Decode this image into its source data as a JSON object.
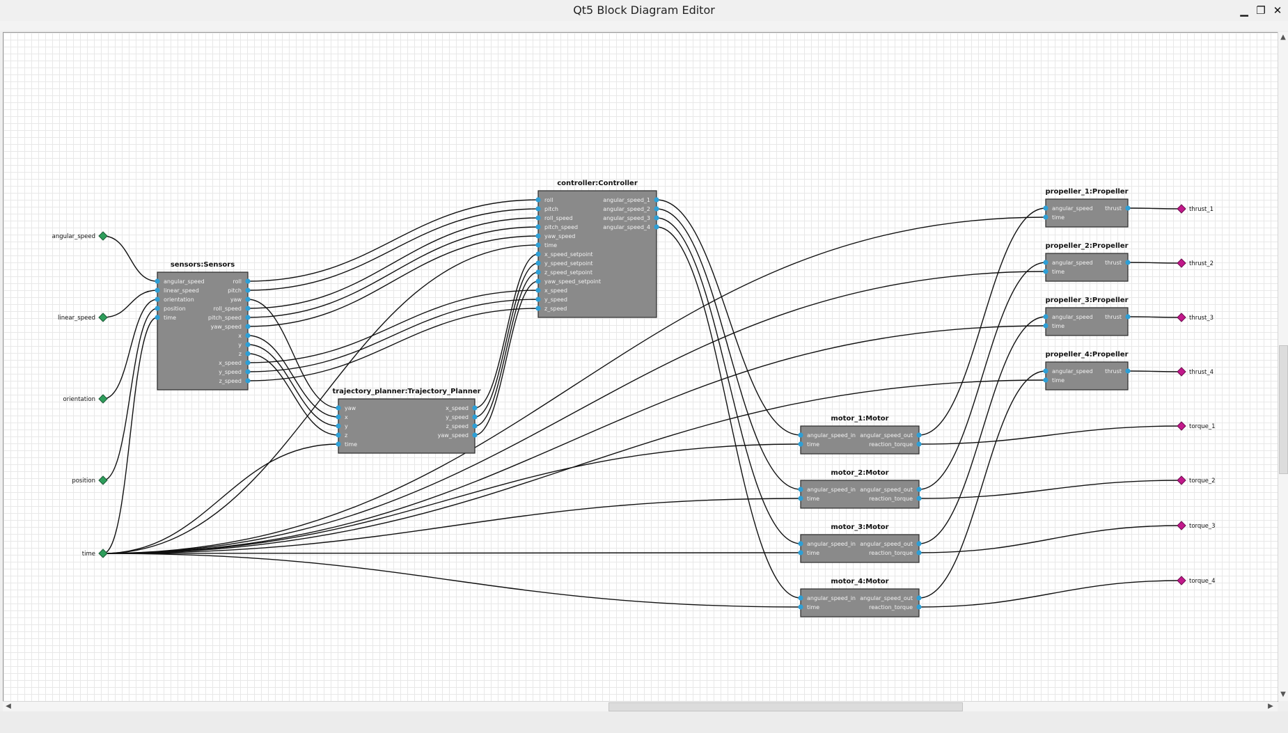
{
  "window": {
    "title": "Qt5 Block Diagram Editor",
    "min_glyph": "▁",
    "max_glyph": "❐",
    "close_glyph": "✕"
  },
  "scroll": {
    "up": "▲",
    "down": "▼",
    "left": "◀",
    "right": "▶"
  },
  "colors": {
    "block_fill": "#8a8a8a",
    "block_border": "#2a2a2a",
    "port": "#2d9fd6",
    "input_terminal": "#2e9e5b",
    "output_terminal": "#c2188b",
    "wire": "#111111",
    "grid": "#e8e8e8"
  },
  "inputs": [
    {
      "id": "angular_speed",
      "label": "angular_speed"
    },
    {
      "id": "linear_speed",
      "label": "linear_speed"
    },
    {
      "id": "orientation",
      "label": "orientation"
    },
    {
      "id": "position",
      "label": "position"
    },
    {
      "id": "time",
      "label": "time"
    }
  ],
  "outputs": [
    {
      "id": "thrust_1",
      "label": "thrust_1"
    },
    {
      "id": "thrust_2",
      "label": "thrust_2"
    },
    {
      "id": "thrust_3",
      "label": "thrust_3"
    },
    {
      "id": "thrust_4",
      "label": "thrust_4"
    },
    {
      "id": "torque_1",
      "label": "torque_1"
    },
    {
      "id": "torque_2",
      "label": "torque_2"
    },
    {
      "id": "torque_3",
      "label": "torque_3"
    },
    {
      "id": "torque_4",
      "label": "torque_4"
    }
  ],
  "blocks": [
    {
      "id": "sensors",
      "title": "sensors:Sensors",
      "inputs": [
        "angular_speed",
        "linear_speed",
        "orientation",
        "position",
        "time"
      ],
      "outputs": [
        "roll",
        "pitch",
        "yaw",
        "roll_speed",
        "pitch_speed",
        "yaw_speed",
        "x",
        "y",
        "z",
        "x_speed",
        "y_speed",
        "z_speed"
      ]
    },
    {
      "id": "controller",
      "title": "controller:Controller",
      "inputs": [
        "roll",
        "pitch",
        "roll_speed",
        "pitch_speed",
        "yaw_speed",
        "time",
        "x_speed_setpoint",
        "y_speed_setpoint",
        "z_speed_setpoint",
        "yaw_speed_setpoint",
        "x_speed",
        "y_speed",
        "z_speed"
      ],
      "outputs": [
        "angular_speed_1",
        "angular_speed_2",
        "angular_speed_3",
        "angular_speed_4"
      ]
    },
    {
      "id": "trajectory_planner",
      "title": "trajectory_planner:Trajectory_Planner",
      "inputs": [
        "yaw",
        "x",
        "y",
        "z",
        "time"
      ],
      "outputs": [
        "x_speed",
        "y_speed",
        "z_speed",
        "yaw_speed"
      ]
    },
    {
      "id": "propeller_1",
      "title": "propeller_1:Propeller",
      "inputs": [
        "angular_speed",
        "time"
      ],
      "outputs": [
        "thrust"
      ]
    },
    {
      "id": "propeller_2",
      "title": "propeller_2:Propeller",
      "inputs": [
        "angular_speed",
        "time"
      ],
      "outputs": [
        "thrust"
      ]
    },
    {
      "id": "propeller_3",
      "title": "propeller_3:Propeller",
      "inputs": [
        "angular_speed",
        "time"
      ],
      "outputs": [
        "thrust"
      ]
    },
    {
      "id": "propeller_4",
      "title": "propeller_4:Propeller",
      "inputs": [
        "angular_speed",
        "time"
      ],
      "outputs": [
        "thrust"
      ]
    },
    {
      "id": "motor_1",
      "title": "motor_1:Motor",
      "inputs": [
        "angular_speed_in",
        "time"
      ],
      "outputs": [
        "angular_speed_out",
        "reaction_torque"
      ]
    },
    {
      "id": "motor_2",
      "title": "motor_2:Motor",
      "inputs": [
        "angular_speed_in",
        "time"
      ],
      "outputs": [
        "angular_speed_out",
        "reaction_torque"
      ]
    },
    {
      "id": "motor_3",
      "title": "motor_3:Motor",
      "inputs": [
        "angular_speed_in",
        "time"
      ],
      "outputs": [
        "angular_speed_out",
        "reaction_torque"
      ]
    },
    {
      "id": "motor_4",
      "title": "motor_4:Motor",
      "inputs": [
        "angular_speed_in",
        "time"
      ],
      "outputs": [
        "angular_speed_out",
        "reaction_torque"
      ]
    }
  ],
  "connections": [
    {
      "from": "in:angular_speed",
      "to": "sensors.in.angular_speed"
    },
    {
      "from": "in:linear_speed",
      "to": "sensors.in.linear_speed"
    },
    {
      "from": "in:orientation",
      "to": "sensors.in.orientation"
    },
    {
      "from": "in:position",
      "to": "sensors.in.position"
    },
    {
      "from": "in:time",
      "to": "sensors.in.time"
    },
    {
      "from": "in:time",
      "to": "controller.in.time"
    },
    {
      "from": "in:time",
      "to": "trajectory_planner.in.time"
    },
    {
      "from": "in:time",
      "to": "propeller_1.in.time"
    },
    {
      "from": "in:time",
      "to": "propeller_2.in.time"
    },
    {
      "from": "in:time",
      "to": "propeller_3.in.time"
    },
    {
      "from": "in:time",
      "to": "propeller_4.in.time"
    },
    {
      "from": "in:time",
      "to": "motor_1.in.time"
    },
    {
      "from": "in:time",
      "to": "motor_2.in.time"
    },
    {
      "from": "in:time",
      "to": "motor_3.in.time"
    },
    {
      "from": "in:time",
      "to": "motor_4.in.time"
    },
    {
      "from": "sensors.out.roll",
      "to": "controller.in.roll"
    },
    {
      "from": "sensors.out.pitch",
      "to": "controller.in.pitch"
    },
    {
      "from": "sensors.out.roll_speed",
      "to": "controller.in.roll_speed"
    },
    {
      "from": "sensors.out.pitch_speed",
      "to": "controller.in.pitch_speed"
    },
    {
      "from": "sensors.out.yaw_speed",
      "to": "controller.in.yaw_speed"
    },
    {
      "from": "sensors.out.x_speed",
      "to": "controller.in.x_speed"
    },
    {
      "from": "sensors.out.y_speed",
      "to": "controller.in.y_speed"
    },
    {
      "from": "sensors.out.z_speed",
      "to": "controller.in.z_speed"
    },
    {
      "from": "sensors.out.yaw",
      "to": "trajectory_planner.in.yaw"
    },
    {
      "from": "sensors.out.x",
      "to": "trajectory_planner.in.x"
    },
    {
      "from": "sensors.out.y",
      "to": "trajectory_planner.in.y"
    },
    {
      "from": "sensors.out.z",
      "to": "trajectory_planner.in.z"
    },
    {
      "from": "trajectory_planner.out.x_speed",
      "to": "controller.in.x_speed_setpoint"
    },
    {
      "from": "trajectory_planner.out.y_speed",
      "to": "controller.in.y_speed_setpoint"
    },
    {
      "from": "trajectory_planner.out.z_speed",
      "to": "controller.in.z_speed_setpoint"
    },
    {
      "from": "trajectory_planner.out.yaw_speed",
      "to": "controller.in.yaw_speed_setpoint"
    },
    {
      "from": "controller.out.angular_speed_1",
      "to": "motor_1.in.angular_speed_in"
    },
    {
      "from": "controller.out.angular_speed_2",
      "to": "motor_2.in.angular_speed_in"
    },
    {
      "from": "controller.out.angular_speed_3",
      "to": "motor_3.in.angular_speed_in"
    },
    {
      "from": "controller.out.angular_speed_4",
      "to": "motor_4.in.angular_speed_in"
    },
    {
      "from": "motor_1.out.angular_speed_out",
      "to": "propeller_1.in.angular_speed"
    },
    {
      "from": "motor_2.out.angular_speed_out",
      "to": "propeller_2.in.angular_speed"
    },
    {
      "from": "motor_3.out.angular_speed_out",
      "to": "propeller_3.in.angular_speed"
    },
    {
      "from": "motor_4.out.angular_speed_out",
      "to": "propeller_4.in.angular_speed"
    },
    {
      "from": "propeller_1.out.thrust",
      "to": "out:thrust_1"
    },
    {
      "from": "propeller_2.out.thrust",
      "to": "out:thrust_2"
    },
    {
      "from": "propeller_3.out.thrust",
      "to": "out:thrust_3"
    },
    {
      "from": "propeller_4.out.thrust",
      "to": "out:thrust_4"
    },
    {
      "from": "motor_1.out.reaction_torque",
      "to": "out:torque_1"
    },
    {
      "from": "motor_2.out.reaction_torque",
      "to": "out:torque_2"
    },
    {
      "from": "motor_3.out.reaction_torque",
      "to": "out:torque_3"
    },
    {
      "from": "motor_4.out.reaction_torque",
      "to": "out:torque_4"
    }
  ]
}
